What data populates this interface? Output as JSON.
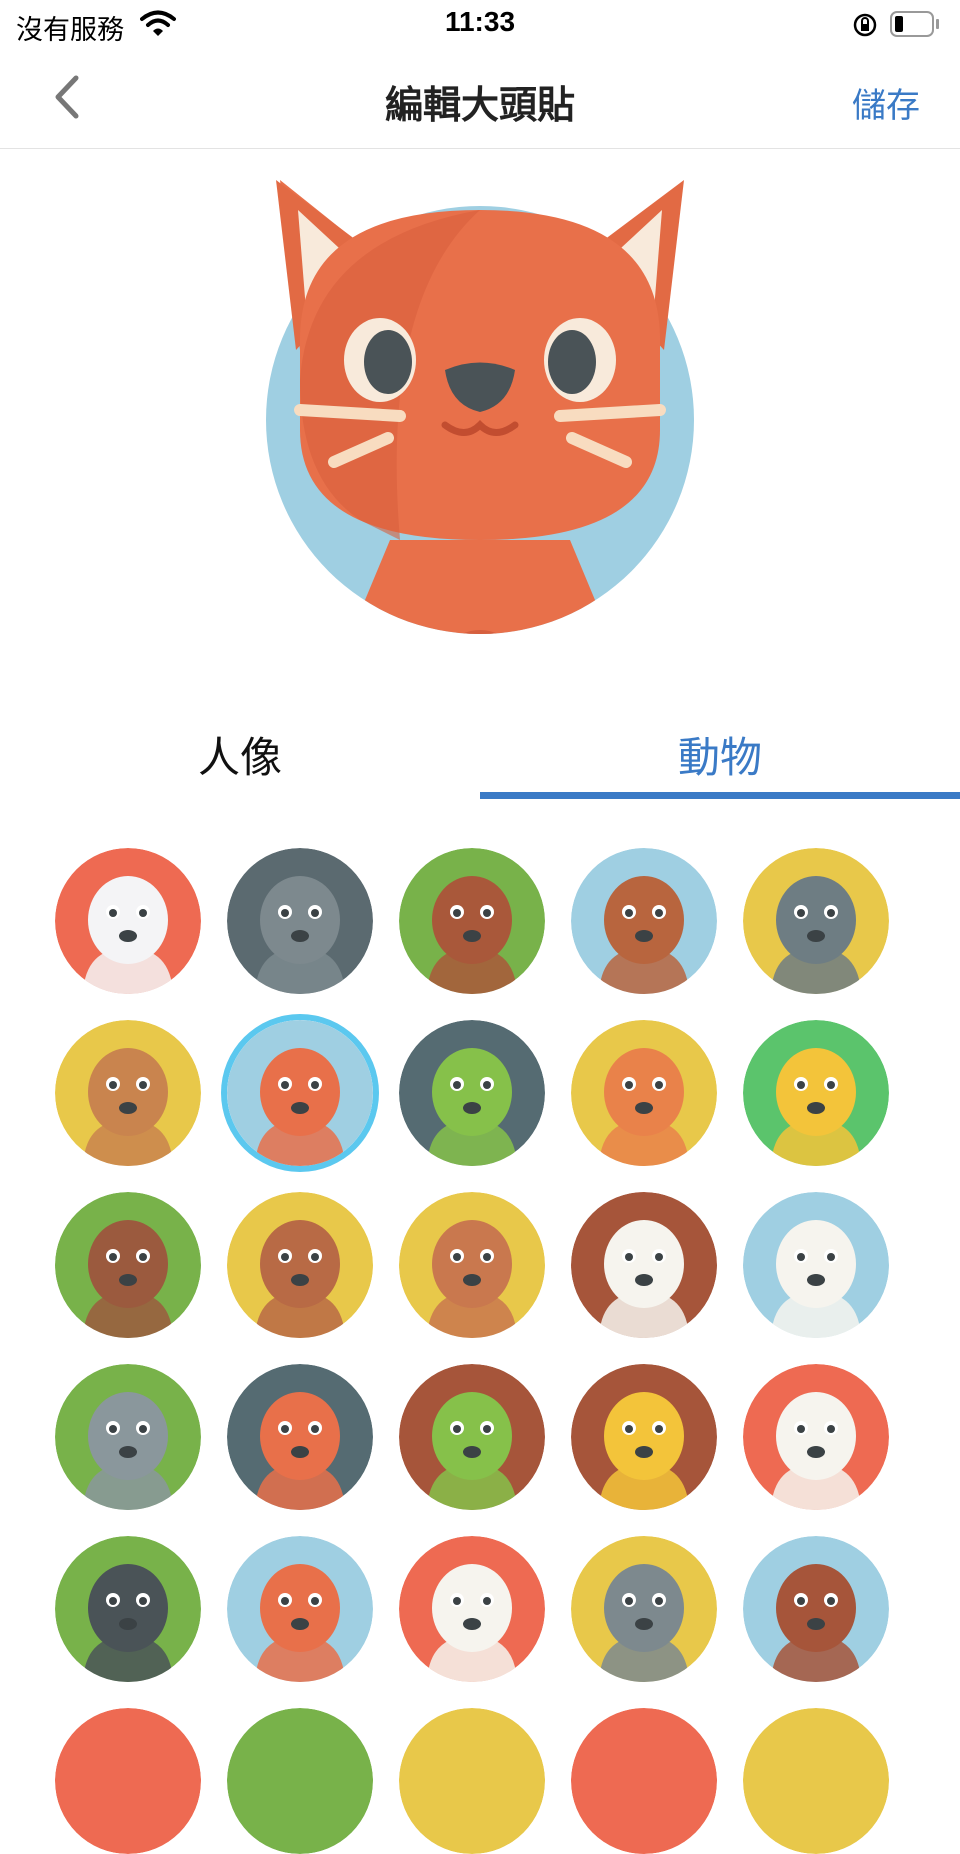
{
  "status_bar": {
    "carrier": "沒有服務",
    "time": "11:33",
    "icons": [
      "wifi-icon",
      "orientation-lock-icon",
      "battery-icon"
    ]
  },
  "nav": {
    "back_icon": "chevron-left-icon",
    "title": "編輯大頭貼",
    "save_label": "儲存"
  },
  "preview": {
    "avatar": "cat"
  },
  "tabs": [
    {
      "label": "人像",
      "selected": false
    },
    {
      "label": "動物",
      "selected": true
    }
  ],
  "colors": {
    "accent": "#3a7ac6",
    "selection_ring": "#5bc8ef"
  },
  "grid": {
    "items": [
      {
        "animal": "chicken-white",
        "bg": "#ee6a52"
      },
      {
        "animal": "mouse",
        "bg": "#5b6a70"
      },
      {
        "animal": "bear",
        "bg": "#78b24a"
      },
      {
        "animal": "beaver",
        "bg": "#9fcfe2"
      },
      {
        "animal": "buffalo",
        "bg": "#e8c84a"
      },
      {
        "animal": "camel",
        "bg": "#e8c84a"
      },
      {
        "animal": "cat",
        "bg": "#9fcfe2",
        "selected": true
      },
      {
        "animal": "chameleon",
        "bg": "#556b72"
      },
      {
        "animal": "cheetah",
        "bg": "#e8c84a"
      },
      {
        "animal": "chick",
        "bg": "#5bc46c"
      },
      {
        "animal": "cow",
        "bg": "#78b24a"
      },
      {
        "animal": "deer",
        "bg": "#e8c84a"
      },
      {
        "animal": "dog",
        "bg": "#e8c84a"
      },
      {
        "animal": "goose",
        "bg": "#a6553a"
      },
      {
        "animal": "eagle",
        "bg": "#9fcfe2"
      },
      {
        "animal": "elephant",
        "bg": "#78b24a"
      },
      {
        "animal": "fox",
        "bg": "#556b72"
      },
      {
        "animal": "frog",
        "bg": "#a6553a"
      },
      {
        "animal": "giraffe",
        "bg": "#a6553a"
      },
      {
        "animal": "goat",
        "bg": "#ee6a52"
      },
      {
        "animal": "gorilla",
        "bg": "#78b24a"
      },
      {
        "animal": "hamster",
        "bg": "#9fcfe2"
      },
      {
        "animal": "rooster",
        "bg": "#ee6a52"
      },
      {
        "animal": "hippo",
        "bg": "#e8c84a"
      },
      {
        "animal": "horse",
        "bg": "#9fcfe2"
      },
      {
        "animal": "partial-1",
        "bg": "#ee6a52"
      },
      {
        "animal": "partial-2",
        "bg": "#78b24a"
      },
      {
        "animal": "partial-3",
        "bg": "#e8c84a"
      },
      {
        "animal": "partial-4",
        "bg": "#ee6a52"
      },
      {
        "animal": "partial-5",
        "bg": "#e8c84a"
      }
    ]
  }
}
